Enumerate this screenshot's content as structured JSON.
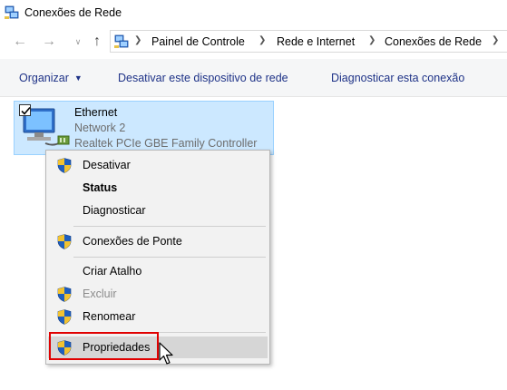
{
  "window": {
    "title": "Conexões de Rede",
    "icon": "network-connections-icon"
  },
  "navigation": {
    "back_icon": "back-arrow-icon",
    "forward_icon": "forward-arrow-icon",
    "recent_icon": "chevron-down-icon",
    "up_icon": "up-arrow-icon",
    "breadcrumbs": [
      "Painel de Controle",
      "Rede e Internet",
      "Conexões de Rede"
    ]
  },
  "commandbar": {
    "organize": "Organizar",
    "disable_device": "Desativar este dispositivo de rede",
    "diagnose": "Diagnosticar esta conexão"
  },
  "network_item": {
    "name": "Ethernet",
    "network": "Network  2",
    "adapter": "Realtek PCIe GBE Family Controller",
    "checked": true
  },
  "context_menu": {
    "items": [
      {
        "label": "Desativar",
        "shield": true,
        "bold": false,
        "disabled": false
      },
      {
        "label": "Status",
        "shield": false,
        "bold": true,
        "disabled": false
      },
      {
        "label": "Diagnosticar",
        "shield": false,
        "bold": false,
        "disabled": false
      },
      {
        "label": "Conexões de Ponte",
        "shield": true,
        "bold": false,
        "disabled": false
      },
      {
        "label": "Criar Atalho",
        "shield": false,
        "bold": false,
        "disabled": false
      },
      {
        "label": "Excluir",
        "shield": true,
        "bold": false,
        "disabled": true
      },
      {
        "label": "Renomear",
        "shield": true,
        "bold": false,
        "disabled": false
      },
      {
        "label": "Propriedades",
        "shield": true,
        "bold": false,
        "disabled": false,
        "hovered": true
      }
    ]
  },
  "colors": {
    "selection_bg": "#cce8ff",
    "highlight_box": "#e00000",
    "command_text": "#1e3287"
  }
}
